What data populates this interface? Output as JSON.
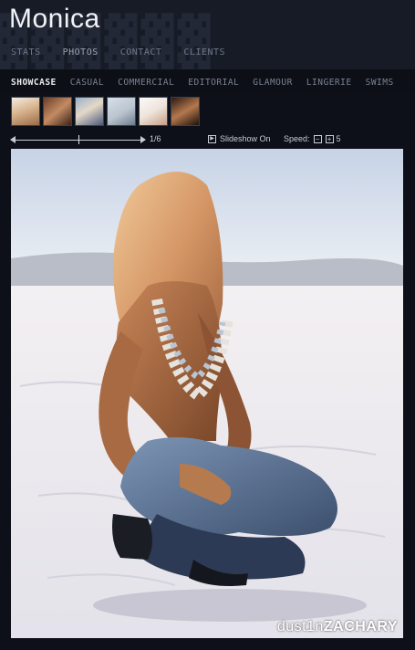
{
  "header": {
    "title": "Monica",
    "nav": [
      {
        "label": "STATS"
      },
      {
        "label": "PHOTOS"
      },
      {
        "label": "CONTACT"
      },
      {
        "label": "CLIENTS"
      }
    ]
  },
  "categories": [
    {
      "label": "SHOWCASE"
    },
    {
      "label": "CASUAL"
    },
    {
      "label": "COMMERCIAL"
    },
    {
      "label": "EDITORIAL"
    },
    {
      "label": "GLAMOUR"
    },
    {
      "label": "LINGERIE"
    },
    {
      "label": "SWIMS"
    }
  ],
  "controls": {
    "counter": "1/6",
    "slideshow_label": "Slideshow On",
    "speed_label": "Speed:",
    "speed_minus": "−",
    "speed_plus": "+",
    "speed_value": "5"
  },
  "photo": {
    "credit_light": "dust1n",
    "credit_bold": "ZACHARY"
  },
  "colors": {
    "background": "#0d1019",
    "header": "#171b26",
    "active_text": "#e8eaef",
    "inactive_text": "#7b8293"
  }
}
